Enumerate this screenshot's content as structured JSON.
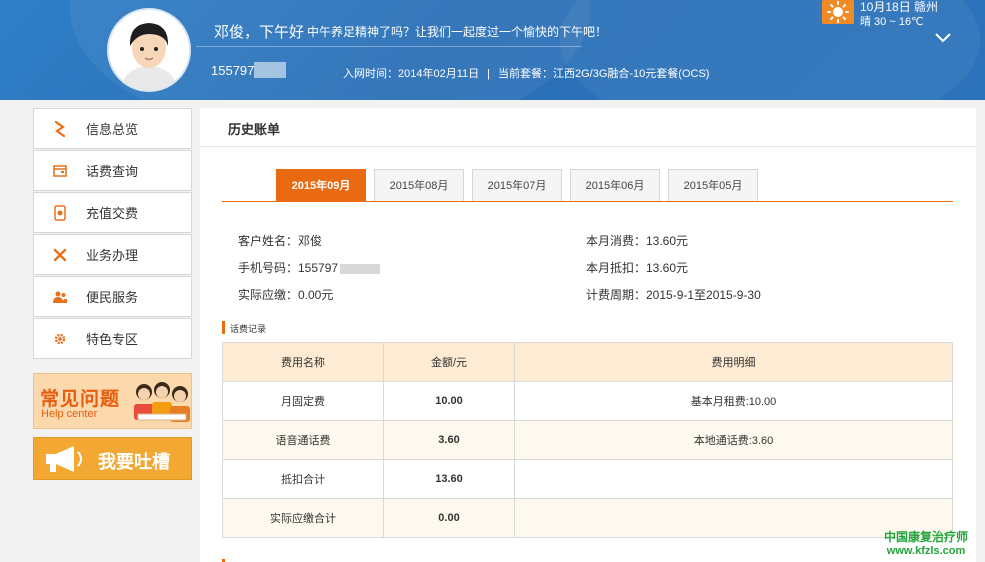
{
  "header": {
    "greeting": "邓俊，下午好",
    "slogan": "中午养足精神了吗？让我们一起度过一个愉快的下午吧！",
    "phone": "155797",
    "join_label": "入网时间：2014年02月11日",
    "separator": "|",
    "plan_label": "当前套餐：江西2G/3G融合-10元套餐(OCS)"
  },
  "weather": {
    "date_city": "10月18日 赣州",
    "temp": "晴 30 ~ 16℃",
    "icon": "sun-icon"
  },
  "sidebar": {
    "items": [
      {
        "label": "信息总览",
        "icon": "overview-icon"
      },
      {
        "label": "话费查询",
        "icon": "bill-icon"
      },
      {
        "label": "充值交费",
        "icon": "recharge-icon"
      },
      {
        "label": "业务办理",
        "icon": "tools-icon"
      },
      {
        "label": "便民服务",
        "icon": "users-icon"
      },
      {
        "label": "特色专区",
        "icon": "gear-icon"
      }
    ],
    "help_title": "常见问题",
    "help_sub": "Help center",
    "tucao": "我要吐槽"
  },
  "main": {
    "title": "历史账单",
    "tabs": [
      "2015年09月",
      "2015年08月",
      "2015年07月",
      "2015年06月",
      "2015年05月"
    ],
    "active_tab": 0,
    "customer": "客户姓名：邓俊",
    "phone": "手机号码：155797",
    "due": "实际应缴：0.00元",
    "month_spend": "本月消费：13.60元",
    "month_deduct": "本月抵扣：13.60元",
    "period": "计费周期：2015-9-1至2015-9-30",
    "section": "话费记录",
    "table": {
      "headers": [
        "费用名称",
        "金额/元",
        "费用明细"
      ],
      "rows": [
        {
          "name": "月固定费",
          "amount": "10.00",
          "detail": "基本月租费:10.00"
        },
        {
          "name": "语音通话费",
          "amount": "3.60",
          "detail": "本地通话费:3.60"
        },
        {
          "name": "抵扣合计",
          "amount": "13.60",
          "detail": ""
        },
        {
          "name": "实际应缴合计",
          "amount": "0.00",
          "detail": ""
        }
      ]
    }
  },
  "watermark": {
    "line1": "中国康复治疗师",
    "line2": "www.kfzls.com"
  },
  "colors": {
    "accent": "#ea6a12",
    "header_blue": "#2f7fc7"
  }
}
